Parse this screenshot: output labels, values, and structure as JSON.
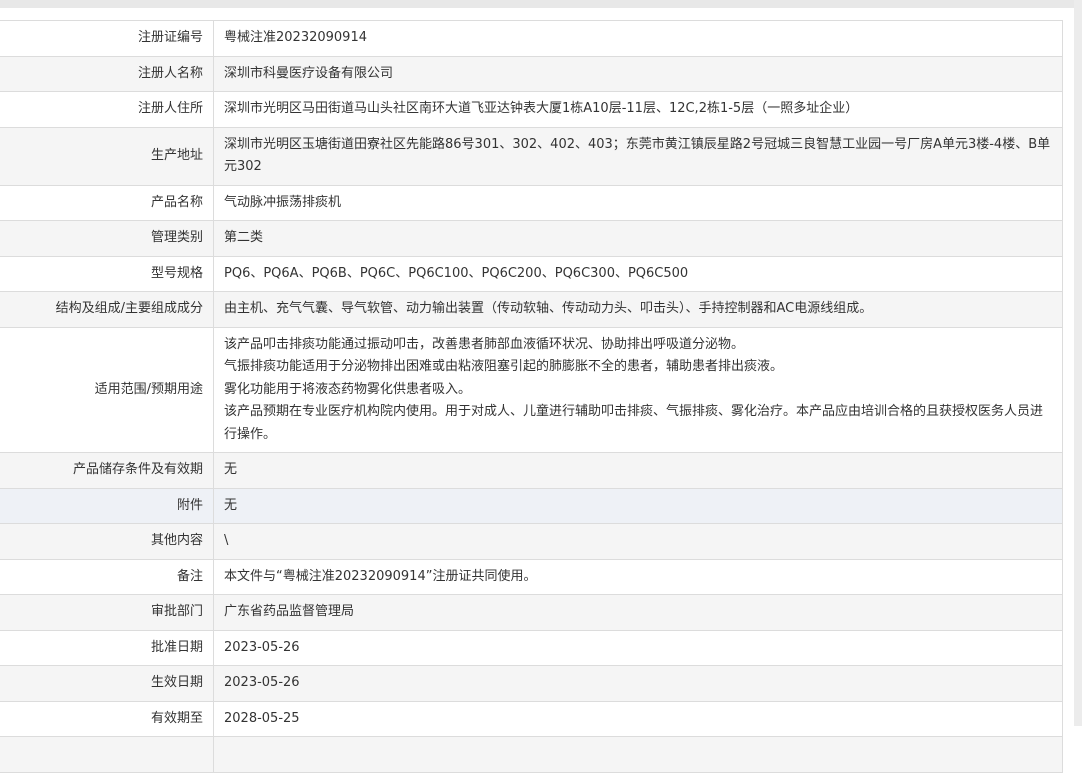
{
  "rows": [
    {
      "label": "注册证编号",
      "value": "粤械注准20232090914"
    },
    {
      "label": "注册人名称",
      "value": "深圳市科曼医疗设备有限公司"
    },
    {
      "label": "注册人住所",
      "value": "深圳市光明区马田街道马山头社区南环大道飞亚达钟表大厦1栋A10层-11层、12C,2栋1-5层（一照多址企业）"
    },
    {
      "label": "生产地址",
      "value": "深圳市光明区玉塘街道田寮社区先能路86号301、302、402、403；东莞市黄江镇辰星路2号冠城三良智慧工业园一号厂房A单元3楼-4楼、B单元302"
    },
    {
      "label": "产品名称",
      "value": "气动脉冲振荡排痰机"
    },
    {
      "label": "管理类别",
      "value": "第二类"
    },
    {
      "label": "型号规格",
      "value": "PQ6、PQ6A、PQ6B、PQ6C、PQ6C100、PQ6C200、PQ6C300、PQ6C500"
    },
    {
      "label": "结构及组成/主要组成成分",
      "value": "由主机、充气气囊、导气软管、动力输出装置（传动软轴、传动动力头、叩击头）、手持控制器和AC电源线组成。"
    },
    {
      "label": "适用范围/预期用途",
      "lines": [
        "该产品叩击排痰功能通过振动叩击，改善患者肺部血液循环状况、协助排出呼吸道分泌物。",
        "气振排痰功能适用于分泌物排出困难或由粘液阻塞引起的肺膨胀不全的患者，辅助患者排出痰液。",
        "雾化功能用于将液态药物雾化供患者吸入。",
        "该产品预期在专业医疗机构院内使用。用于对成人、儿童进行辅助叩击排痰、气振排痰、雾化治疗。本产品应由培训合格的且获授权医务人员进行操作。"
      ]
    },
    {
      "label": "产品储存条件及有效期",
      "value": "无"
    },
    {
      "label": "附件",
      "value": "无"
    },
    {
      "label": "其他内容",
      "value": "\\"
    },
    {
      "label": "备注",
      "value": "本文件与“粤械注准20232090914”注册证共同使用。"
    },
    {
      "label": "审批部门",
      "value": "广东省药品监督管理局"
    },
    {
      "label": "批准日期",
      "value": "2023-05-26"
    },
    {
      "label": "生效日期",
      "value": "2023-05-26"
    },
    {
      "label": "有效期至",
      "value": "2028-05-25"
    }
  ]
}
